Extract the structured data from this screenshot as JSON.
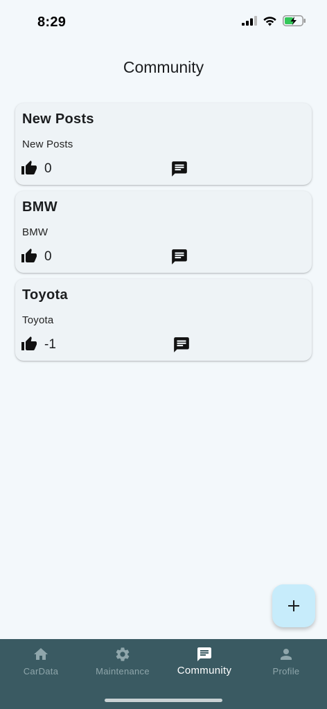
{
  "status_bar": {
    "time": "8:29",
    "icons": [
      "cellular-signal-icon",
      "wifi-icon",
      "battery-charging-icon"
    ]
  },
  "header": {
    "title": "Community"
  },
  "posts": [
    {
      "title": "New Posts",
      "body": "New Posts",
      "likes": "0"
    },
    {
      "title": "BMW",
      "body": "BMW",
      "likes": "0"
    },
    {
      "title": "Toyota",
      "body": "Toyota",
      "likes": "-1"
    }
  ],
  "fab": {
    "icon": "plus-icon"
  },
  "bottom_nav": {
    "items": [
      {
        "label": "CarData",
        "icon": "home-icon"
      },
      {
        "label": "Maintenance",
        "icon": "gear-icon"
      },
      {
        "label": "Community",
        "icon": "chat-icon",
        "active": true
      },
      {
        "label": "Profile",
        "icon": "person-icon"
      }
    ]
  },
  "colors": {
    "background": "#f3f8fb",
    "card": "#eef3f6",
    "nav_background": "#3a5a62",
    "fab": "#c7ecfb",
    "battery": "#34c759"
  }
}
